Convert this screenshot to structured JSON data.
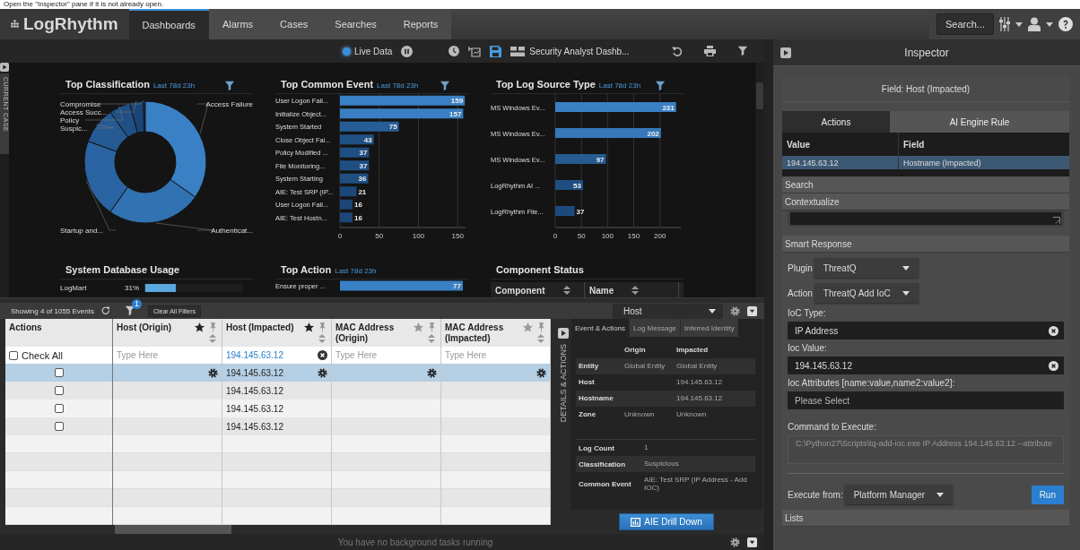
{
  "instruction": "Open the \"Inspector\" pane if it is not already open.",
  "nav": {
    "logo": "LogRhythm",
    "tabs": [
      {
        "label": "Dashboards",
        "selected": true
      },
      {
        "label": "Alarms",
        "selected": false
      },
      {
        "label": "Cases",
        "selected": false
      },
      {
        "label": "Searches",
        "selected": false
      },
      {
        "label": "Reports",
        "selected": false
      }
    ],
    "search_button": "Search..."
  },
  "dashboard_toolbar": {
    "live_data": {
      "label": "Live Data",
      "on": true
    },
    "dashboard_name": "Security Analyst Dashb..."
  },
  "current_case_tab": "CURRENT CASE",
  "widgets": [
    {
      "kind": "donut",
      "title": "Top Classification",
      "subtitle": "Last 78d 23h",
      "filterable": true,
      "slice_labels": [
        "Compromise",
        "Access Failure",
        "Access Succ...",
        "Policy",
        "Suspic...",
        "Startup and...",
        "Authenticat..."
      ]
    },
    {
      "kind": "bar",
      "title": "Top Common Event",
      "subtitle": "Last 78d 23h",
      "filterable": true,
      "chart_data": {
        "type": "bar",
        "orientation": "horizontal",
        "categories": [
          "User Logon Fail...",
          "Initialize Object...",
          "System Started",
          "Close Object Fai...",
          "Policy Modified ...",
          "File Monitoring...",
          "System Starting",
          "AIE: Test SRP (IP...",
          "User Logon Fail...",
          "AIE: Test Hostn..."
        ],
        "values": [
          159,
          157,
          75,
          43,
          37,
          37,
          36,
          21,
          16,
          16
        ],
        "xlim": [
          0,
          160
        ],
        "xticks": [
          0,
          50,
          100,
          150
        ],
        "grid": true,
        "data_labels": true
      }
    },
    {
      "kind": "bar",
      "title": "Top Log Source Type",
      "subtitle": "Last 78d 23h",
      "filterable": true,
      "chart_data": {
        "type": "bar",
        "orientation": "horizontal",
        "categories": [
          "MS Windows Ev...",
          "MS Windows Ev...",
          "MS Windows Ev...",
          "LogRhythm AI ...",
          "LogRhythm File..."
        ],
        "values": [
          231,
          202,
          97,
          53,
          37
        ],
        "xlim": [
          0,
          240
        ],
        "xticks": [
          0,
          50,
          100,
          150,
          200
        ],
        "grid": true,
        "data_labels": true
      }
    },
    {
      "kind": "meter",
      "title": "System Database Usage",
      "rows": [
        {
          "label": "LogMart",
          "reading": "31%",
          "level": 0.31
        }
      ]
    },
    {
      "kind": "bar",
      "title": "Top Action",
      "subtitle": "Last 78d 23h",
      "chart_data": {
        "type": "bar",
        "orientation": "horizontal",
        "categories": [
          "Ensure proper ..."
        ],
        "values": [
          77
        ],
        "data_labels": true
      }
    },
    {
      "kind": "table",
      "title": "Component Status",
      "columns": [
        "Component",
        "Name"
      ]
    }
  ],
  "grid": {
    "summary": "Showing 4 of 1055 Events",
    "filter_count": "1",
    "clear_button": "Clear All Filters",
    "group_by": "Host",
    "columns": [
      {
        "label": "Actions"
      },
      {
        "label": "Host (Origin)",
        "starred": true
      },
      {
        "label": "Host (Impacted)",
        "starred": true
      },
      {
        "label": "MAC Address (Origin)",
        "starred": false
      },
      {
        "label": "MAC Address (Impacted)",
        "starred": false
      }
    ],
    "check_all": {
      "label": "Check All",
      "checked": false
    },
    "filters": [
      {
        "placeholder": "Type Here"
      },
      {
        "value": "194.145.63.12"
      },
      {
        "placeholder": "Type Here"
      },
      {
        "placeholder": "Type Here"
      }
    ],
    "rows": [
      {
        "selected": true,
        "checked": false,
        "cells": [
          "",
          "194.145.63.12",
          "",
          ""
        ]
      },
      {
        "selected": false,
        "checked": false,
        "cells": [
          "",
          "194.145.63.12",
          "",
          ""
        ]
      },
      {
        "selected": false,
        "checked": false,
        "cells": [
          "",
          "194.145.63.12",
          "",
          ""
        ]
      },
      {
        "selected": false,
        "checked": false,
        "cells": [
          "",
          "194.145.63.12",
          "",
          ""
        ]
      }
    ]
  },
  "details": {
    "side_tab": "DETAILS & ACTIONS",
    "tabs": [
      {
        "label": "Event & Actions",
        "selected": true
      },
      {
        "label": "Log Message",
        "selected": false
      },
      {
        "label": "Inferred Identity",
        "selected": false
      }
    ],
    "entity_columns": [
      "Origin",
      "Impacted"
    ],
    "entity_rows": [
      {
        "label": "Entity",
        "origin": "Global Entity",
        "impacted": "Global Entity"
      },
      {
        "label": "Host",
        "origin": "",
        "impacted": "194.145.63.12"
      },
      {
        "label": "Hostname",
        "origin": "",
        "impacted": "194.145.63.12"
      },
      {
        "label": "Zone",
        "origin": "Unknown",
        "impacted": "Unknown"
      }
    ],
    "summary_rows": [
      {
        "label": "Log Count",
        "value": "1"
      },
      {
        "label": "Classification",
        "value": "Suspicious"
      },
      {
        "label": "Common Event",
        "value": "AIE: Test SRP (IP Address - Add IOC)"
      }
    ],
    "button": "AIE Drill Down"
  },
  "background_tasks": "You have no background tasks running",
  "inspector": {
    "title": "Inspector",
    "field": "Field: Host (Impacted)",
    "tabs": [
      {
        "label": "Actions",
        "selected": true
      },
      {
        "label": "AI Engine Rule",
        "selected": false
      }
    ],
    "columns": [
      "Value",
      "Field"
    ],
    "rows": [
      {
        "selected": true,
        "cells": [
          "194.145.63.12",
          "Hostname (Impacted)"
        ]
      }
    ],
    "search_section": "Search",
    "contextualize_section": "Contextualize",
    "smart_response_section": "Smart Response",
    "plugin": {
      "label": "Plugin",
      "value": "ThreatQ"
    },
    "action": {
      "label": "Action",
      "value": "ThreatQ Add IoC"
    },
    "fields": [
      {
        "label": "IoC Type:",
        "value": "IP Address"
      },
      {
        "label": "Ioc Value:",
        "value": "194.145.63.12"
      },
      {
        "label": "Ioc Attributes [name:value,name2:value2]:",
        "placeholder": "Please Select"
      }
    ],
    "command": {
      "label": "Command to Execute:",
      "value": "C:\\Python27\\Scripts\\tq-add-ioc.exe IP Address 194.145.63.12 --attribute"
    },
    "execute_from": {
      "label": "Execute from:",
      "value": "Platform Manager"
    },
    "run_button": "Run",
    "lists_section": "Lists"
  }
}
